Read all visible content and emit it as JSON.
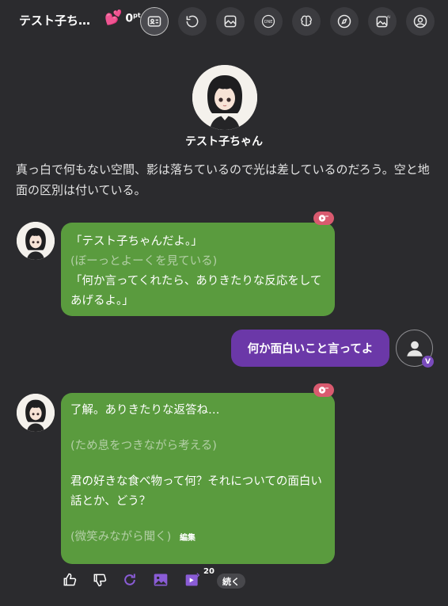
{
  "header": {
    "title": "テスト子ち…",
    "affinity_value": "0",
    "affinity_unit": "pt"
  },
  "profile": {
    "name": "テスト子ちゃん"
  },
  "scene_text": "真っ白で何もない空間、影は落ちているので光は差しているのだろう。空と地面の区別は付いている。",
  "messages": [
    {
      "role": "ai",
      "lines": [
        {
          "text": "「テスト子ちゃんだよ。」",
          "style": "normal"
        },
        {
          "text": "(ぼーっとよーくを見ている)",
          "style": "muted"
        },
        {
          "text": "「何か言ってくれたら、ありきたりな反応をしてあげるよ。」",
          "style": "normal"
        }
      ]
    },
    {
      "role": "user",
      "text": "何か面白いこと言ってよ",
      "badge": "V"
    },
    {
      "role": "ai",
      "lines": [
        {
          "text": "了解。ありきたりな返答ね…",
          "style": "normal"
        },
        {
          "text": "(ため息をつきながら考える)",
          "style": "muted"
        },
        {
          "text": "君の好きな食べ物って何？それについての面白い話とか、どう？",
          "style": "normal"
        },
        {
          "text": "(微笑みながら聞く)",
          "style": "muted"
        }
      ],
      "edit_label": "編集"
    }
  ],
  "actions": {
    "image_count": "20",
    "continue_label": "続く"
  },
  "colors": {
    "background": "#2b2b2e",
    "ai_bubble": "#5a9b3e",
    "user_bubble": "#6b38a8",
    "voice_badge": "#d95a6f",
    "accent_purple": "#8a5cd6"
  },
  "icons": [
    "heart-icon",
    "profile-card-icon",
    "reset-icon",
    "image-icon",
    "one-icon",
    "brain-icon",
    "compass-icon",
    "ai-image-icon",
    "user-icon",
    "voice-play-icon",
    "thumbs-up-icon",
    "thumbs-down-icon",
    "regenerate-icon",
    "picture-icon",
    "video-icon"
  ]
}
